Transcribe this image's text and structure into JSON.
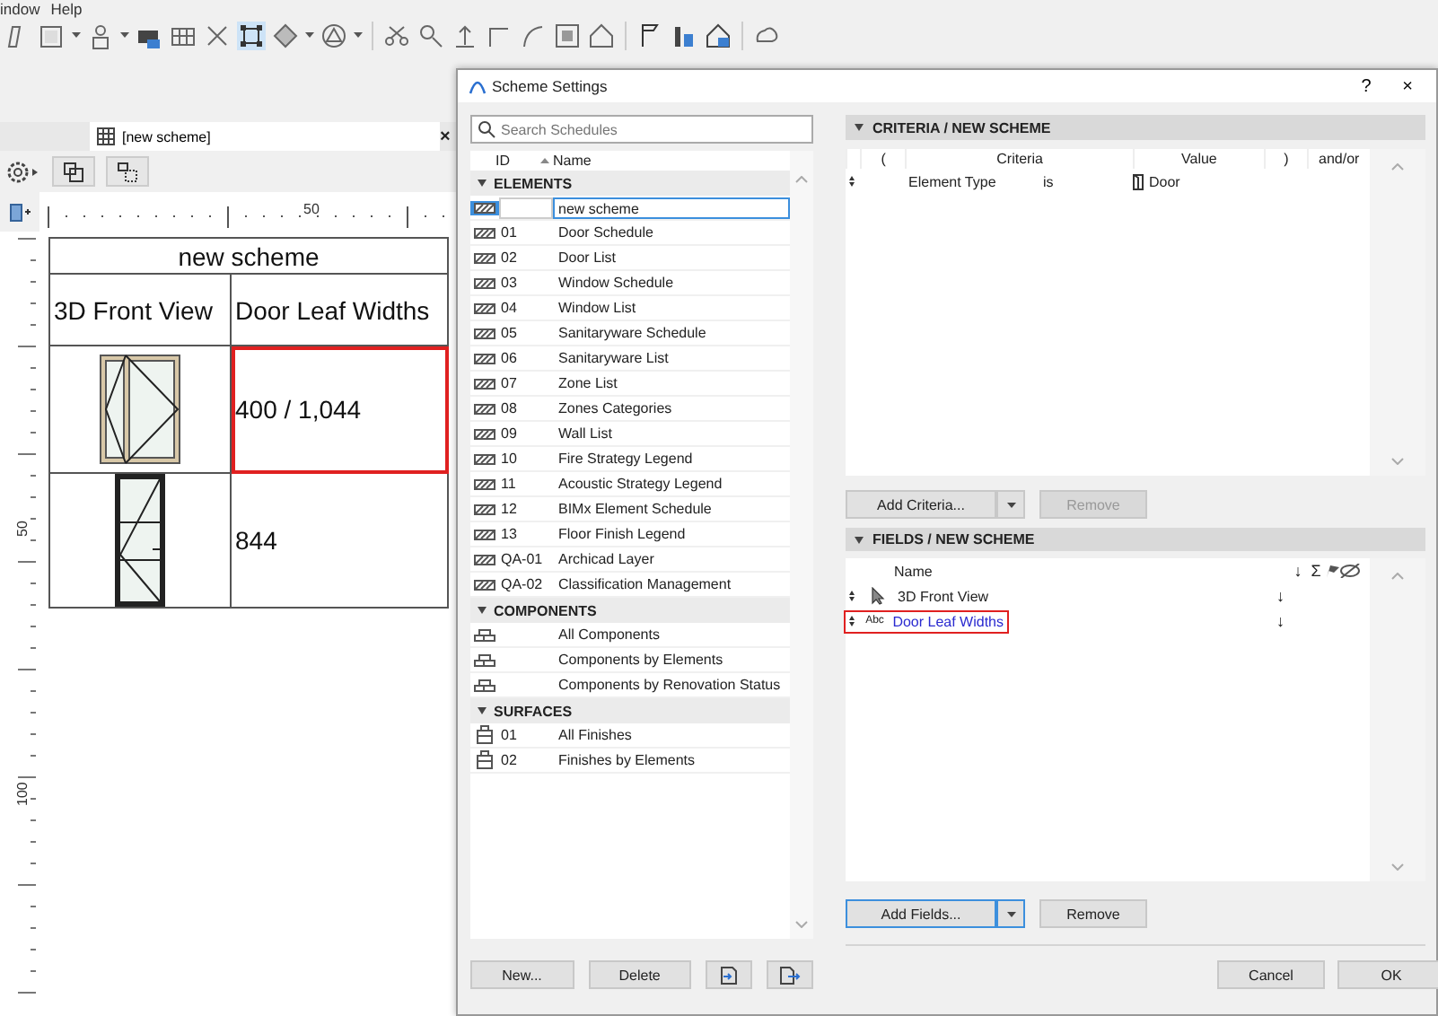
{
  "menu": [
    "indow",
    "Help"
  ],
  "document_tab": {
    "title": "[new scheme]",
    "close": "×"
  },
  "ruler": {
    "top_label": "50",
    "left_labels": [
      "50",
      "100"
    ]
  },
  "schedule": {
    "title": "new scheme",
    "columns": [
      "3D Front View",
      "Door Leaf Widths"
    ],
    "rows": [
      {
        "kind": "window",
        "value": "400 / 1,044",
        "highlighted": true
      },
      {
        "kind": "door",
        "value": "844",
        "highlighted": false
      }
    ]
  },
  "dialog": {
    "title": "Scheme Settings",
    "help": "?",
    "close": "×",
    "search": {
      "placeholder": "Search Schedules"
    },
    "list_columns": [
      "ID",
      "Name"
    ],
    "sections": [
      {
        "title": "ELEMENTS",
        "expanded": true,
        "kind": "element",
        "items": [
          {
            "name": "new scheme",
            "selected": true
          },
          {
            "id": "01",
            "name": "Door Schedule",
            "selected": false
          },
          {
            "id": "02",
            "name": "Door List",
            "selected": false
          },
          {
            "id": "03",
            "name": "Window Schedule",
            "selected": false
          },
          {
            "id": "04",
            "name": "Window List",
            "selected": false
          },
          {
            "id": "05",
            "name": "Sanitaryware Schedule",
            "selected": false
          },
          {
            "id": "06",
            "name": "Sanitaryware List",
            "selected": false
          },
          {
            "id": "07",
            "name": "Zone List",
            "selected": false
          },
          {
            "id": "08",
            "name": "Zones Categories",
            "selected": false
          },
          {
            "id": "09",
            "name": "Wall List",
            "selected": false
          },
          {
            "id": "10",
            "name": "Fire Strategy Legend",
            "selected": false
          },
          {
            "id": "11",
            "name": "Acoustic Strategy Legend",
            "selected": false
          },
          {
            "id": "12",
            "name": "BIMx Element Schedule",
            "selected": false
          },
          {
            "id": "13",
            "name": "Floor Finish Legend",
            "selected": false
          },
          {
            "id": "QA-01",
            "name": "Archicad Layer",
            "selected": false
          },
          {
            "id": "QA-02",
            "name": "Classification Management",
            "selected": false
          }
        ]
      },
      {
        "title": "COMPONENTS",
        "expanded": true,
        "kind": "component",
        "items": [
          {
            "name": "All Components",
            "selected": false
          },
          {
            "name": "Components by Elements",
            "selected": false
          },
          {
            "name": "Components by Renovation Status",
            "selected": false
          }
        ]
      },
      {
        "title": "SURFACES",
        "expanded": true,
        "kind": "surface",
        "items": [
          {
            "id": "01",
            "name": "All Finishes",
            "selected": false
          },
          {
            "id": "02",
            "name": "Finishes by Elements",
            "selected": false
          }
        ]
      }
    ],
    "list_buttons": [
      "New...",
      "Delete"
    ],
    "criteria": {
      "title": "CRITERIA / NEW SCHEME",
      "columns": [
        "(",
        "Criteria",
        "Value",
        ")",
        "and/or"
      ],
      "rows": [
        {
          "criteria": "Element Type",
          "operator": "is",
          "value": "Door",
          "kind": "door"
        }
      ],
      "add_button": "Add Criteria...",
      "remove_button": {
        "label": "Remove",
        "disabled": true
      }
    },
    "fields": {
      "title": "FIELDS / NEW SCHEME",
      "columns": [
        "Name",
        "↓",
        "Σ"
      ],
      "rows": [
        {
          "kind": "view",
          "name": "3D Front View",
          "sort": "↓",
          "selected": false,
          "highlighted": false
        },
        {
          "kind": "text",
          "type_label": "Abc",
          "name": "Door Leaf Widths",
          "sort": "↓",
          "selected": true,
          "highlighted": true
        }
      ],
      "add_button": "Add Fields...",
      "remove_button": {
        "label": "Remove",
        "disabled": false
      }
    },
    "buttons": [
      "Cancel",
      "OK"
    ]
  }
}
